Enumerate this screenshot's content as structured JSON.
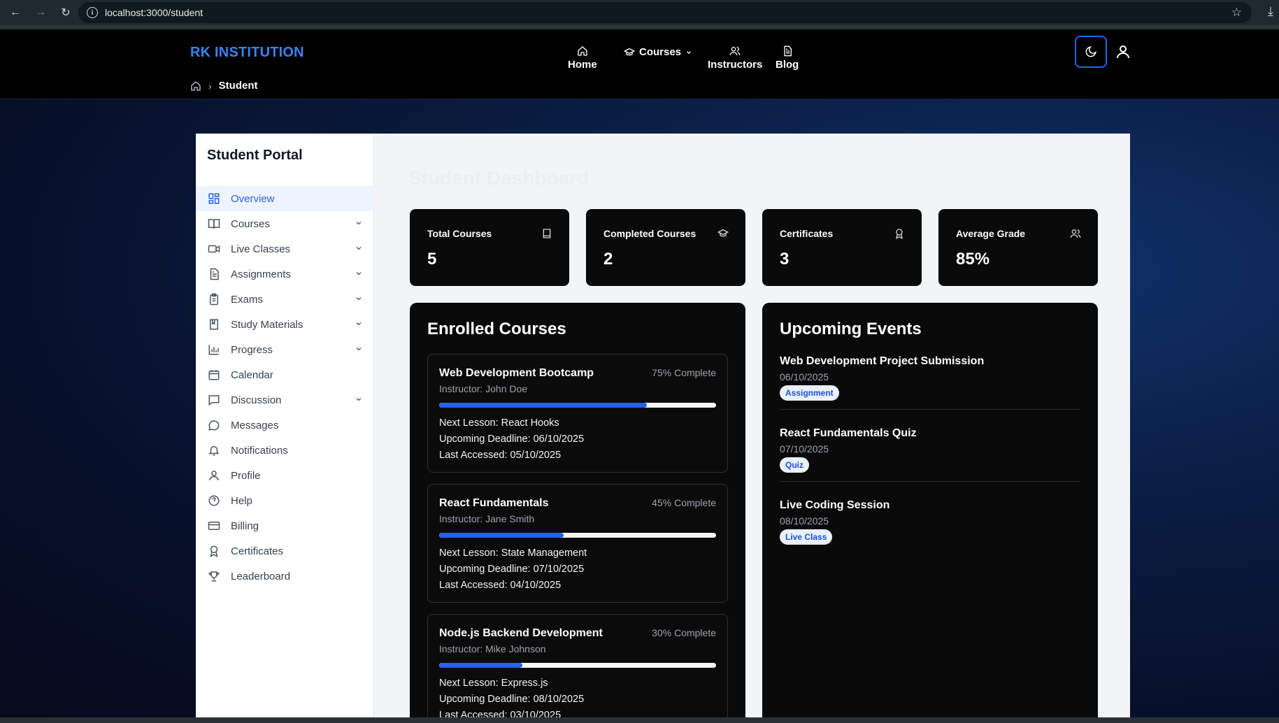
{
  "browser": {
    "url": "localhost:3000/student"
  },
  "header": {
    "logo": "RK INSTITUTION",
    "nav": {
      "home": "Home",
      "courses": "Courses",
      "instructors": "Instructors",
      "blog": "Blog"
    },
    "breadcrumb_current": "Student"
  },
  "sidebar": {
    "title": "Student Portal",
    "items": [
      {
        "label": "Overview",
        "icon": "grid-icon"
      },
      {
        "label": "Courses",
        "icon": "book-open-icon"
      },
      {
        "label": "Live Classes",
        "icon": "video-icon"
      },
      {
        "label": "Assignments",
        "icon": "file-text-icon"
      },
      {
        "label": "Exams",
        "icon": "clipboard-icon"
      },
      {
        "label": "Study Materials",
        "icon": "book-icon"
      },
      {
        "label": "Progress",
        "icon": "bar-chart-icon"
      },
      {
        "label": "Calendar",
        "icon": "calendar-icon"
      },
      {
        "label": "Discussion",
        "icon": "message-square-icon"
      },
      {
        "label": "Messages",
        "icon": "message-circle-icon"
      },
      {
        "label": "Notifications",
        "icon": "bell-icon"
      },
      {
        "label": "Profile",
        "icon": "user-icon"
      },
      {
        "label": "Help",
        "icon": "help-circle-icon"
      },
      {
        "label": "Billing",
        "icon": "credit-card-icon"
      },
      {
        "label": "Certificates",
        "icon": "award-icon"
      },
      {
        "label": "Leaderboard",
        "icon": "trophy-icon"
      }
    ]
  },
  "dashboard": {
    "title": "Student Dashboard",
    "stats": [
      {
        "label": "Total Courses",
        "value": "5",
        "icon": "book-icon"
      },
      {
        "label": "Completed Courses",
        "value": "2",
        "icon": "graduation-cap-icon"
      },
      {
        "label": "Certificates",
        "value": "3",
        "icon": "award-icon"
      },
      {
        "label": "Average Grade",
        "value": "85%",
        "icon": "users-icon"
      }
    ],
    "enrolled": {
      "title": "Enrolled Courses",
      "courses": [
        {
          "name": "Web Development Bootcamp",
          "progress_text": "75% Complete",
          "progress": 0.75,
          "instructor": "Instructor: John Doe",
          "next_lesson": "Next Lesson: React Hooks",
          "deadline": "Upcoming Deadline: 06/10/2025",
          "last_accessed": "Last Accessed: 05/10/2025"
        },
        {
          "name": "React Fundamentals",
          "progress_text": "45% Complete",
          "progress": 0.45,
          "instructor": "Instructor: Jane Smith",
          "next_lesson": "Next Lesson: State Management",
          "deadline": "Upcoming Deadline: 07/10/2025",
          "last_accessed": "Last Accessed: 04/10/2025"
        },
        {
          "name": "Node.js Backend Development",
          "progress_text": "30% Complete",
          "progress": 0.3,
          "instructor": "Instructor: Mike Johnson",
          "next_lesson": "Next Lesson: Express.js",
          "deadline": "Upcoming Deadline: 08/10/2025",
          "last_accessed": "Last Accessed: 03/10/2025"
        }
      ]
    },
    "events": {
      "title": "Upcoming Events",
      "items": [
        {
          "name": "Web Development Project Submission",
          "date": "06/10/2025",
          "tag": "Assignment"
        },
        {
          "name": "React Fundamentals Quiz",
          "date": "07/10/2025",
          "tag": "Quiz"
        },
        {
          "name": "Live Coding Session",
          "date": "08/10/2025",
          "tag": "Live Class"
        }
      ]
    }
  },
  "colors": {
    "accent": "#2563eb",
    "logo": "#3b82f6",
    "card_bg": "#0a0a0a"
  }
}
